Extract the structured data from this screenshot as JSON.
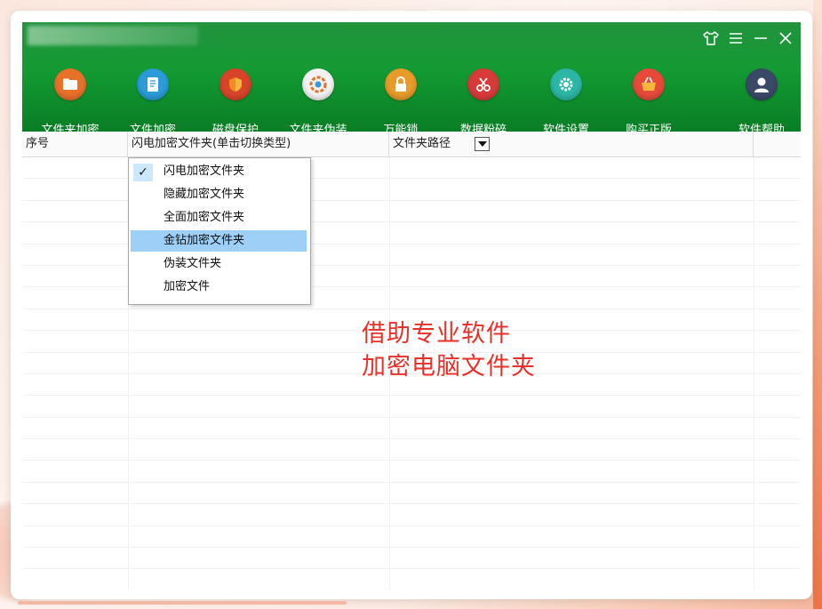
{
  "window": {
    "controls": [
      "shirt-icon",
      "menu-icon",
      "minimize-icon",
      "close-icon"
    ]
  },
  "toolbar": {
    "items": [
      {
        "label": "文件夹加密",
        "icon": "folder-lock-icon",
        "color": "#e8712a"
      },
      {
        "label": "文件加密",
        "icon": "file-lock-icon",
        "color": "#2b9ad8"
      },
      {
        "label": "磁盘保护",
        "icon": "disk-shield-icon",
        "color": "#d8442a"
      },
      {
        "label": "文件夹伪装",
        "icon": "disguise-icon",
        "color": "#f2f2f2"
      },
      {
        "label": "万能锁",
        "icon": "padlock-icon",
        "color": "#e89a2a"
      },
      {
        "label": "数据粉碎",
        "icon": "scissors-icon",
        "color": "#d83a3a"
      },
      {
        "label": "软件设置",
        "icon": "gear-icon",
        "color": "#2cb6a6"
      },
      {
        "label": "购买正版",
        "icon": "basket-icon",
        "color": "#e84a3a"
      },
      {
        "label": "软件帮助",
        "icon": "user-help-icon",
        "color": "#3a4a66"
      }
    ]
  },
  "grid": {
    "columns": [
      "序号",
      "闪电加密文件夹(单击切换类型)",
      "文件夹路径"
    ]
  },
  "dropdown": {
    "options": [
      "闪电加密文件夹",
      "隐藏加密文件夹",
      "全面加密文件夹",
      "金钻加密文件夹",
      "伪装文件夹",
      "加密文件"
    ],
    "checked": "闪电加密文件夹",
    "highlighted": "金钻加密文件夹"
  },
  "overlay": {
    "line1": "借助专业软件",
    "line2": "加密电脑文件夹"
  }
}
